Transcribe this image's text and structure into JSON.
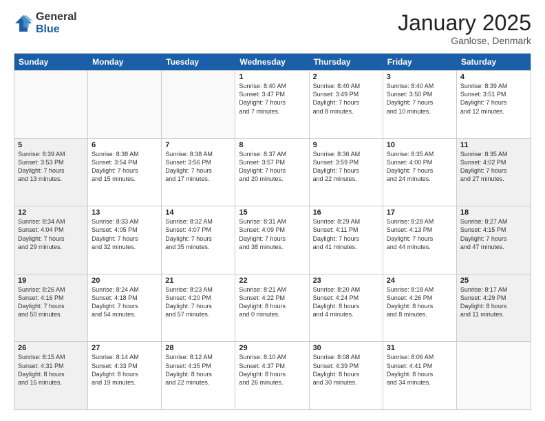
{
  "logo": {
    "general": "General",
    "blue": "Blue"
  },
  "title": "January 2025",
  "subtitle": "Ganlose, Denmark",
  "weekdays": [
    "Sunday",
    "Monday",
    "Tuesday",
    "Wednesday",
    "Thursday",
    "Friday",
    "Saturday"
  ],
  "rows": [
    [
      {
        "day": "",
        "info": "",
        "empty": true
      },
      {
        "day": "",
        "info": "",
        "empty": true
      },
      {
        "day": "",
        "info": "",
        "empty": true
      },
      {
        "day": "1",
        "info": "Sunrise: 8:40 AM\nSunset: 3:47 PM\nDaylight: 7 hours\nand 7 minutes."
      },
      {
        "day": "2",
        "info": "Sunrise: 8:40 AM\nSunset: 3:49 PM\nDaylight: 7 hours\nand 8 minutes."
      },
      {
        "day": "3",
        "info": "Sunrise: 8:40 AM\nSunset: 3:50 PM\nDaylight: 7 hours\nand 10 minutes."
      },
      {
        "day": "4",
        "info": "Sunrise: 8:39 AM\nSunset: 3:51 PM\nDaylight: 7 hours\nand 12 minutes."
      }
    ],
    [
      {
        "day": "5",
        "info": "Sunrise: 8:39 AM\nSunset: 3:53 PM\nDaylight: 7 hours\nand 13 minutes.",
        "shaded": true
      },
      {
        "day": "6",
        "info": "Sunrise: 8:38 AM\nSunset: 3:54 PM\nDaylight: 7 hours\nand 15 minutes."
      },
      {
        "day": "7",
        "info": "Sunrise: 8:38 AM\nSunset: 3:56 PM\nDaylight: 7 hours\nand 17 minutes."
      },
      {
        "day": "8",
        "info": "Sunrise: 8:37 AM\nSunset: 3:57 PM\nDaylight: 7 hours\nand 20 minutes."
      },
      {
        "day": "9",
        "info": "Sunrise: 8:36 AM\nSunset: 3:59 PM\nDaylight: 7 hours\nand 22 minutes."
      },
      {
        "day": "10",
        "info": "Sunrise: 8:35 AM\nSunset: 4:00 PM\nDaylight: 7 hours\nand 24 minutes."
      },
      {
        "day": "11",
        "info": "Sunrise: 8:35 AM\nSunset: 4:02 PM\nDaylight: 7 hours\nand 27 minutes.",
        "shaded": true
      }
    ],
    [
      {
        "day": "12",
        "info": "Sunrise: 8:34 AM\nSunset: 4:04 PM\nDaylight: 7 hours\nand 29 minutes.",
        "shaded": true
      },
      {
        "day": "13",
        "info": "Sunrise: 8:33 AM\nSunset: 4:05 PM\nDaylight: 7 hours\nand 32 minutes."
      },
      {
        "day": "14",
        "info": "Sunrise: 8:32 AM\nSunset: 4:07 PM\nDaylight: 7 hours\nand 35 minutes."
      },
      {
        "day": "15",
        "info": "Sunrise: 8:31 AM\nSunset: 4:09 PM\nDaylight: 7 hours\nand 38 minutes."
      },
      {
        "day": "16",
        "info": "Sunrise: 8:29 AM\nSunset: 4:11 PM\nDaylight: 7 hours\nand 41 minutes."
      },
      {
        "day": "17",
        "info": "Sunrise: 8:28 AM\nSunset: 4:13 PM\nDaylight: 7 hours\nand 44 minutes."
      },
      {
        "day": "18",
        "info": "Sunrise: 8:27 AM\nSunset: 4:15 PM\nDaylight: 7 hours\nand 47 minutes.",
        "shaded": true
      }
    ],
    [
      {
        "day": "19",
        "info": "Sunrise: 8:26 AM\nSunset: 4:16 PM\nDaylight: 7 hours\nand 50 minutes.",
        "shaded": true
      },
      {
        "day": "20",
        "info": "Sunrise: 8:24 AM\nSunset: 4:18 PM\nDaylight: 7 hours\nand 54 minutes."
      },
      {
        "day": "21",
        "info": "Sunrise: 8:23 AM\nSunset: 4:20 PM\nDaylight: 7 hours\nand 57 minutes."
      },
      {
        "day": "22",
        "info": "Sunrise: 8:21 AM\nSunset: 4:22 PM\nDaylight: 8 hours\nand 0 minutes."
      },
      {
        "day": "23",
        "info": "Sunrise: 8:20 AM\nSunset: 4:24 PM\nDaylight: 8 hours\nand 4 minutes."
      },
      {
        "day": "24",
        "info": "Sunrise: 8:18 AM\nSunset: 4:26 PM\nDaylight: 8 hours\nand 8 minutes."
      },
      {
        "day": "25",
        "info": "Sunrise: 8:17 AM\nSunset: 4:29 PM\nDaylight: 8 hours\nand 11 minutes.",
        "shaded": true
      }
    ],
    [
      {
        "day": "26",
        "info": "Sunrise: 8:15 AM\nSunset: 4:31 PM\nDaylight: 8 hours\nand 15 minutes.",
        "shaded": true
      },
      {
        "day": "27",
        "info": "Sunrise: 8:14 AM\nSunset: 4:33 PM\nDaylight: 8 hours\nand 19 minutes."
      },
      {
        "day": "28",
        "info": "Sunrise: 8:12 AM\nSunset: 4:35 PM\nDaylight: 8 hours\nand 22 minutes."
      },
      {
        "day": "29",
        "info": "Sunrise: 8:10 AM\nSunset: 4:37 PM\nDaylight: 8 hours\nand 26 minutes."
      },
      {
        "day": "30",
        "info": "Sunrise: 8:08 AM\nSunset: 4:39 PM\nDaylight: 8 hours\nand 30 minutes."
      },
      {
        "day": "31",
        "info": "Sunrise: 8:06 AM\nSunset: 4:41 PM\nDaylight: 8 hours\nand 34 minutes."
      },
      {
        "day": "",
        "info": "",
        "empty": true
      }
    ]
  ]
}
